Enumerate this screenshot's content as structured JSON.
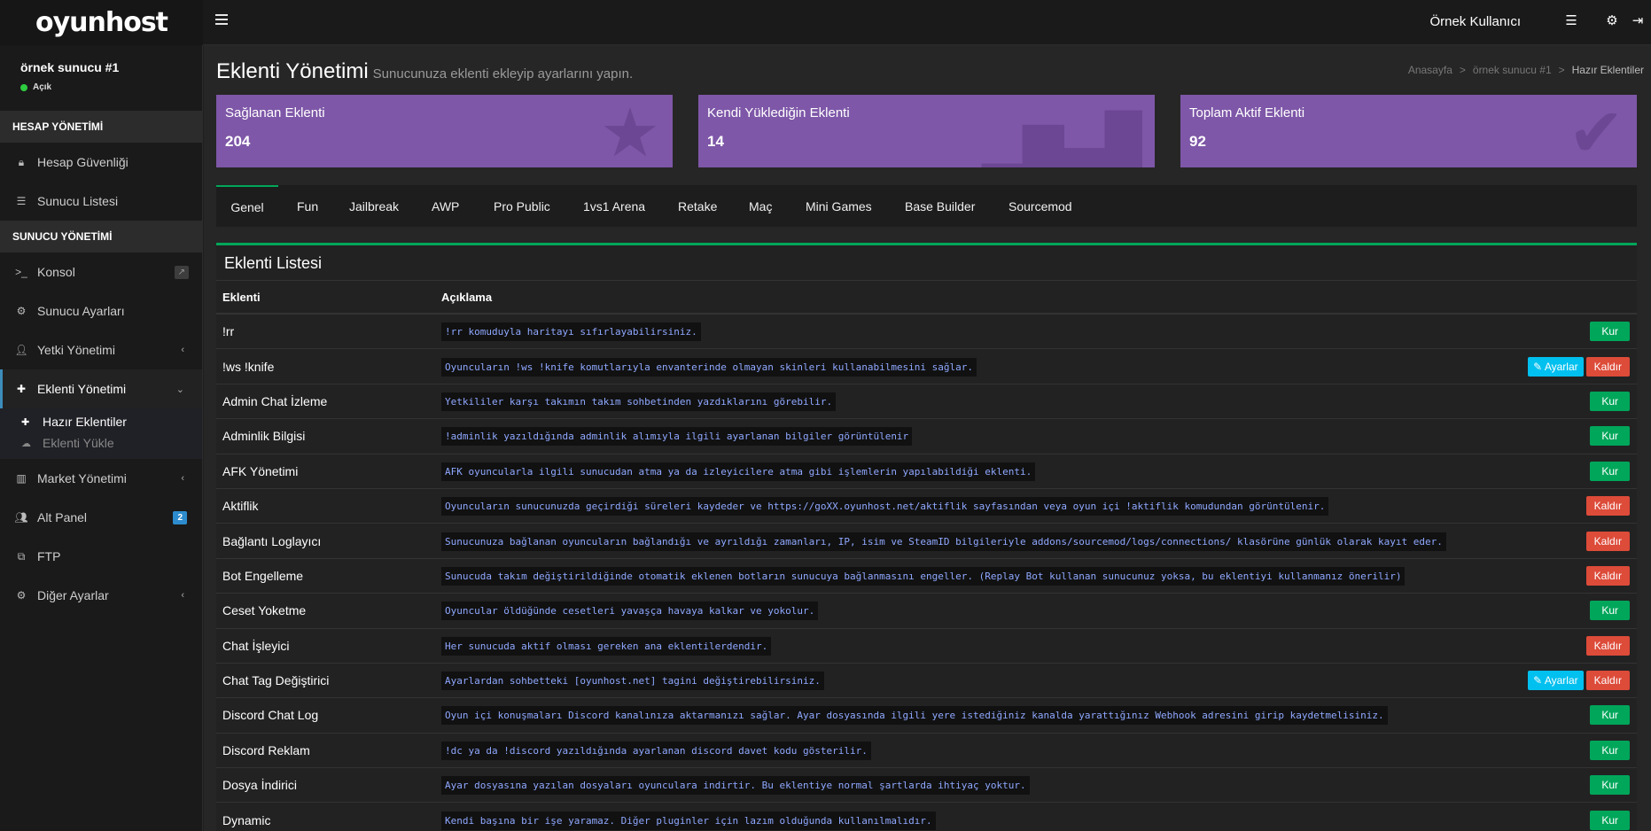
{
  "brand": {
    "logo_text": "oyunhost"
  },
  "topbar": {
    "user_name": "Örnek Kullanıcı"
  },
  "sidebar": {
    "server_name": "örnek sunucu #1",
    "server_status": "Açık",
    "section_account": "HESAP YÖNETİMİ",
    "account_items": [
      {
        "label": "Hesap Güvenliği",
        "icon": "lock-icon"
      },
      {
        "label": "Sunucu Listesi",
        "icon": "server-list-icon"
      }
    ],
    "section_server": "SUNUCU YÖNETİMİ",
    "server_items": [
      {
        "label": "Konsol",
        "icon": "terminal-icon"
      },
      {
        "label": "Sunucu Ayarları",
        "icon": "gear-icon"
      },
      {
        "label": "Yetki Yönetimi",
        "icon": "user-icon"
      },
      {
        "label": "Eklenti Yönetimi",
        "icon": "puzzle-icon"
      },
      {
        "label": "Market Yönetimi",
        "icon": "basket-icon"
      },
      {
        "label": "Alt Panel",
        "icon": "users-icon",
        "badge": "2"
      },
      {
        "label": "FTP",
        "icon": "copy-icon"
      },
      {
        "label": "Diğer Ayarlar",
        "icon": "gear-icon"
      }
    ],
    "sub_items": [
      {
        "label": "Hazır Eklentiler"
      },
      {
        "label": "Eklenti Yükle"
      }
    ]
  },
  "page": {
    "title": "Eklenti Yönetimi",
    "subtitle": "Sunucunuza eklenti ekleyip ayarlarını yapın.",
    "breadcrumb": [
      "Anasayfa",
      "örnek sunucu #1",
      "Hazır Eklentiler"
    ]
  },
  "stats": [
    {
      "label": "Sağlanan Eklenti",
      "value": "204"
    },
    {
      "label": "Kendi Yüklediğin Eklenti",
      "value": "14"
    },
    {
      "label": "Toplam Aktif Eklenti",
      "value": "92"
    }
  ],
  "tabs": [
    "Genel",
    "Fun",
    "Jailbreak",
    "AWP",
    "Pro Public",
    "1vs1 Arena",
    "Retake",
    "Maç",
    "Mini Games",
    "Base Builder",
    "Sourcemod"
  ],
  "list": {
    "title": "Eklenti Listesi",
    "col_name": "Eklenti",
    "col_desc": "Açıklama",
    "btn_install": "Kur",
    "btn_remove": "Kaldır",
    "btn_settings": "Ayarlar",
    "rows": [
      {
        "name": "!rr",
        "desc": "!rr komuduyla haritayı sıfırlayabilirsiniz."
      },
      {
        "name": "!ws !knife",
        "desc": "Oyuncuların !ws !knife komutlarıyla envanterinde olmayan skinleri kullanabilmesini sağlar."
      },
      {
        "name": "Admin Chat İzleme",
        "desc": "Yetkililer karşı takımın takım sohbetinden yazdıklarını görebilir."
      },
      {
        "name": "Adminlik Bilgisi",
        "desc": "!adminlik yazıldığında adminlik alımıyla ilgili ayarlanan bilgiler görüntülenir"
      },
      {
        "name": "AFK Yönetimi",
        "desc": "AFK oyuncularla ilgili sunucudan atma ya da izleyicilere atma gibi işlemlerin yapılabildiği eklenti."
      },
      {
        "name": "Aktiflik",
        "desc": "Oyuncuların sunucunuzda geçirdiği süreleri kaydeder ve https://goXX.oyunhost.net/aktiflik sayfasından veya oyun içi !aktiflik komudundan görüntülenir."
      },
      {
        "name": "Bağlantı Loglayıcı",
        "desc": "Sunucunuza bağlanan oyuncuların bağlandığı ve ayrıldığı zamanları, IP, isim ve SteamID bilgileriyle addons/sourcemod/logs/connections/ klasörüne günlük olarak kayıt eder."
      },
      {
        "name": "Bot Engelleme",
        "desc": "Sunucuda takım değiştirildiğinde otomatik eklenen botların sunucuya bağlanmasını engeller. (Replay Bot kullanan sunucunuz yoksa, bu eklentiyi kullanmanız önerilir)"
      },
      {
        "name": "Ceset Yoketme",
        "desc": "Oyuncular öldüğünde cesetleri yavaşça havaya kalkar ve yokolur."
      },
      {
        "name": "Chat İşleyici",
        "desc": "Her sunucuda aktif olması gereken ana eklentilerdendir."
      },
      {
        "name": "Chat Tag Değiştirici",
        "desc": "Ayarlardan sohbetteki [oyunhost.net] tagini değiştirebilirsiniz."
      },
      {
        "name": "Discord Chat Log",
        "desc": "Oyun içi konuşmaları Discord kanalınıza aktarmanızı sağlar. Ayar dosyasında ilgili yere istediğiniz kanalda yarattığınız Webhook adresini girip kaydetmelisiniz."
      },
      {
        "name": "Discord Reklam",
        "desc": "!dc ya da !discord yazıldığında ayarlanan discord davet kodu gösterilir."
      },
      {
        "name": "Dosya İndirici",
        "desc": "Ayar dosyasına yazılan dosyaları oyunculara indirtir. Bu eklentiye normal şartlarda ihtiyaç yoktur."
      },
      {
        "name": "Dynamic",
        "desc": "Kendi başına bir işe yaramaz. Diğer pluginler için lazım olduğunda kullanılmalıdır."
      }
    ]
  }
}
